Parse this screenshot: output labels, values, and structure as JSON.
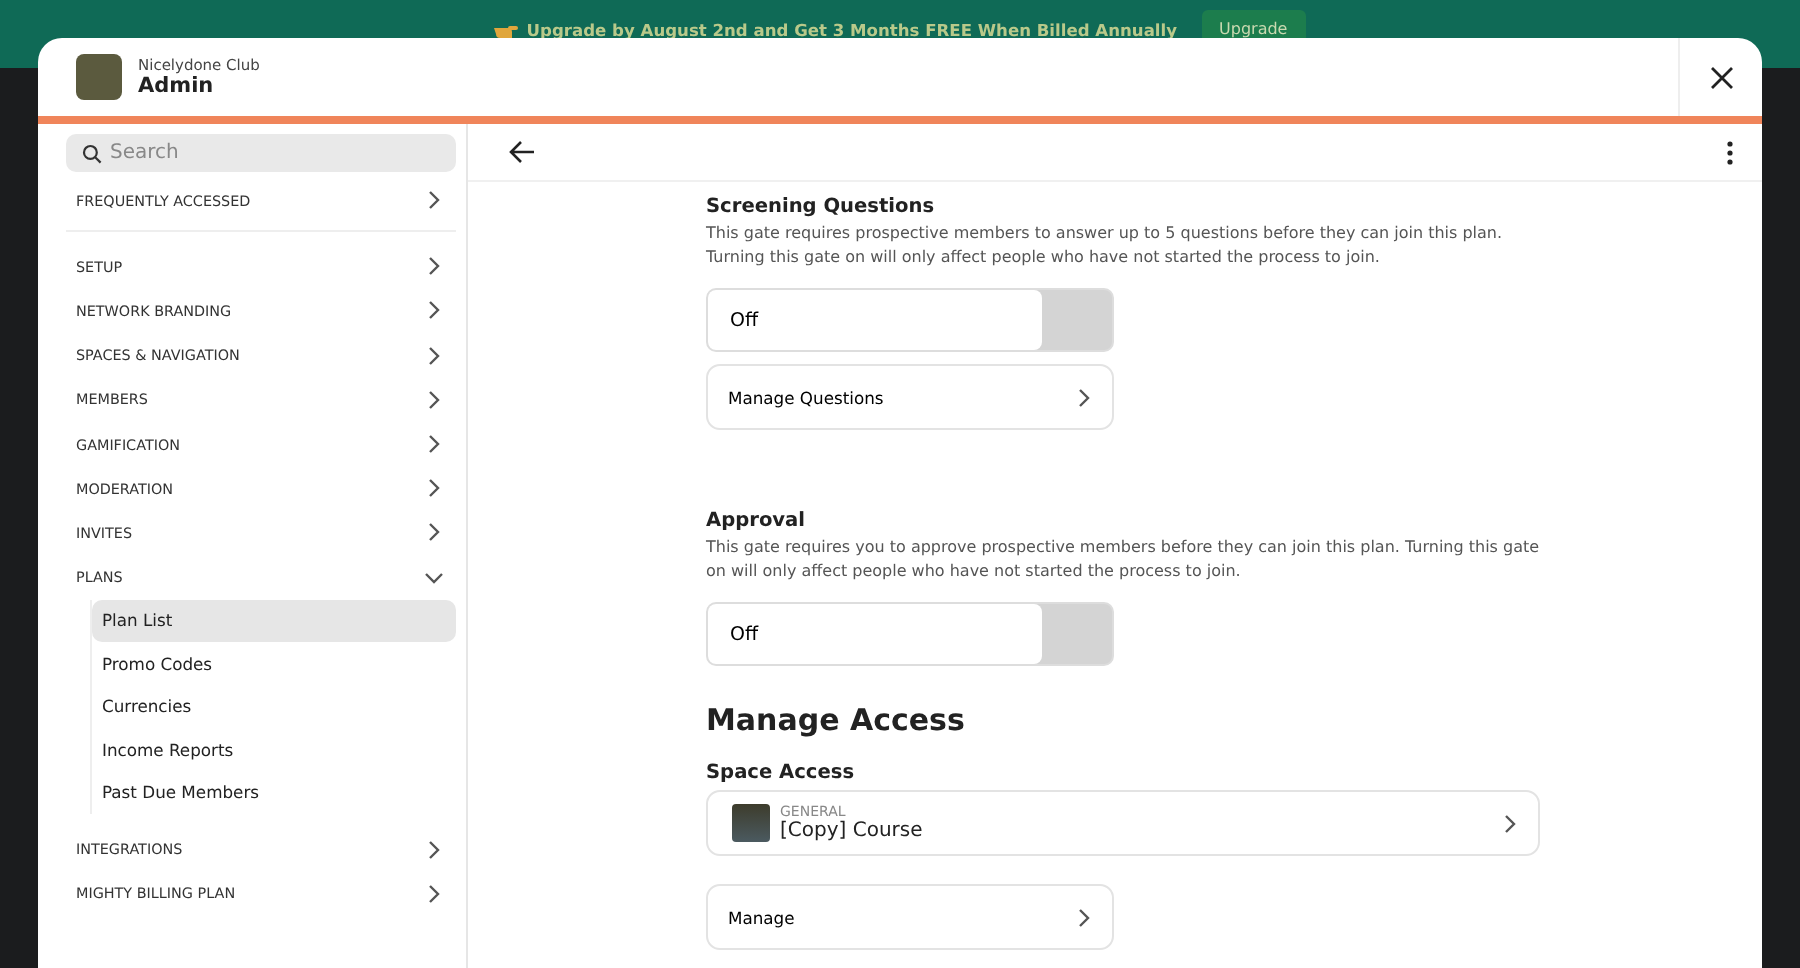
{
  "banner": {
    "message": "Upgrade by August 2nd and Get 3 Months FREE When Billed Annually",
    "button": "Upgrade"
  },
  "modal": {
    "network": "Nicelydone Club",
    "title": "Admin"
  },
  "sidebar": {
    "search": {
      "placeholder": "Search"
    },
    "sections": [
      {
        "label": "FREQUENTLY ACCESSED",
        "expanded": false
      },
      {
        "label": "SETUP",
        "expanded": false
      },
      {
        "label": "NETWORK BRANDING",
        "expanded": false
      },
      {
        "label": "SPACES & NAVIGATION",
        "expanded": false
      },
      {
        "label": "MEMBERS",
        "expanded": false
      },
      {
        "label": "GAMIFICATION",
        "expanded": false
      },
      {
        "label": "MODERATION",
        "expanded": false
      },
      {
        "label": "INVITES",
        "expanded": false
      },
      {
        "label": "PLANS",
        "expanded": true,
        "children": [
          {
            "label": "Plan List",
            "selected": true
          },
          {
            "label": "Promo Codes",
            "selected": false
          },
          {
            "label": "Currencies",
            "selected": false
          },
          {
            "label": "Income Reports",
            "selected": false
          },
          {
            "label": "Past Due Members",
            "selected": false
          }
        ]
      },
      {
        "label": "INTEGRATIONS",
        "expanded": false
      },
      {
        "label": "MIGHTY BILLING PLAN",
        "expanded": false
      }
    ]
  },
  "content": {
    "blocks": [
      {
        "kind": "subheading",
        "text": "Screening Questions"
      },
      {
        "kind": "description",
        "text": "This gate requires prospective members to answer up to 5 questions before they can join this plan. Turning this gate on will only affect people who have not started the process to join."
      },
      {
        "kind": "toggle",
        "label": "Off",
        "on": false
      },
      {
        "kind": "link",
        "label": "Manage Questions"
      },
      {
        "kind": "subheading",
        "text": "Approval"
      },
      {
        "kind": "description",
        "text": "This gate requires you to approve prospective members before they can join this plan. Turning this gate on will only affect people who have not started the process to join."
      },
      {
        "kind": "toggle",
        "label": "Off",
        "on": false
      },
      {
        "kind": "heading",
        "text": "Manage Access"
      },
      {
        "kind": "subheading",
        "text": "Space Access"
      },
      {
        "kind": "space",
        "category": "GENERAL",
        "name": "[Copy] Course"
      },
      {
        "kind": "link",
        "label": "Manage"
      }
    ]
  }
}
